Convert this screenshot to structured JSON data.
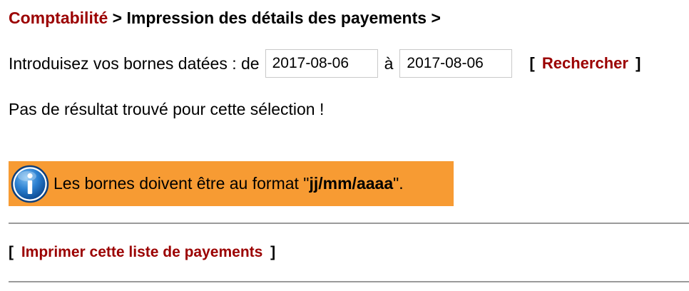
{
  "breadcrumb": {
    "root": "Comptabilité",
    "separator": ">",
    "current": "Impression des détails des payements",
    "trailing_separator": ">"
  },
  "date_filter": {
    "intro_label": "Introduisez vos bornes datées : de",
    "from_value": "2017-08-06",
    "to_label": "à",
    "to_value": "2017-08-06",
    "bracket_open": "[",
    "search_label": "Rechercher",
    "bracket_close": "]"
  },
  "result": {
    "message": "Pas de résultat trouvé pour cette sélection !"
  },
  "info_banner": {
    "icon": "info-icon",
    "text_before": "Les bornes doivent être au format \"",
    "format": "jj/mm/aaaa",
    "text_after": "\".",
    "background": "#f79b33"
  },
  "print": {
    "bracket_open": "[",
    "label": "Imprimer cette liste de payements",
    "bracket_close": "]"
  },
  "colors": {
    "link": "#9b0000",
    "divider": "#9a9a9a"
  }
}
